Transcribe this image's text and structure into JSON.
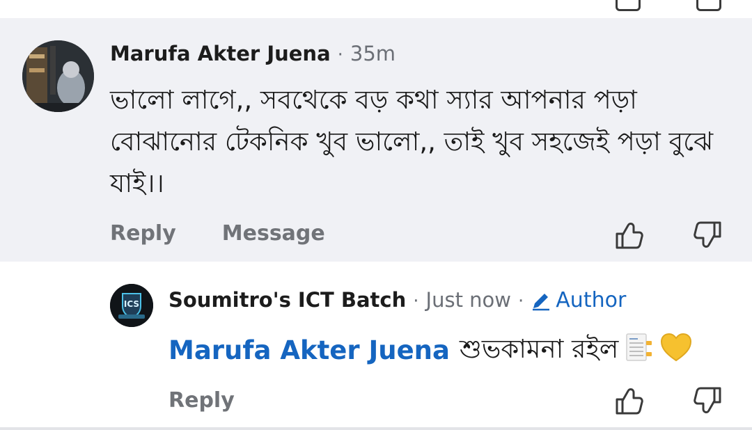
{
  "comments": [
    {
      "author": "Marufa Akter Juena",
      "time": "35m",
      "text": "ভালো লাগে,, সবথেকে বড় কথা স্যার আপনার পড়া বোঝানোর টেকনিক খুব ভালো,, তাই খুব সহজেই পড়া বুঝে যাই।।",
      "actions": {
        "reply": "Reply",
        "message": "Message"
      }
    }
  ],
  "reply": {
    "author": "Soumitro's ICT Batch",
    "time": "Just now",
    "badge": "Author",
    "mention": "Marufa Akter Juena",
    "text": "শুভকামনা রইল",
    "actions": {
      "reply": "Reply"
    },
    "avatar_text": "ICS"
  },
  "colors": {
    "accent": "#1565c0",
    "muted": "#6b6f76",
    "highlight_bg": "#f0f1f5"
  },
  "icons": [
    "thumbs-up-icon",
    "thumbs-down-icon",
    "pencil-icon",
    "clipboard-emoji-icon",
    "yellow-heart-emoji-icon"
  ]
}
